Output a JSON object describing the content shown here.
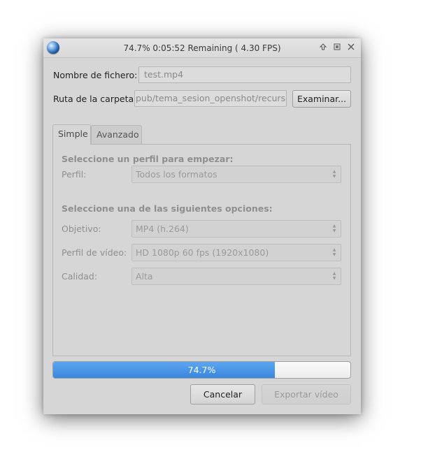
{
  "window": {
    "title": "74.7%  0:05:52 Remaining ( 4.30 FPS)",
    "icon": "openshot-logo-icon",
    "controls": [
      "maximize-icon",
      "restore-icon",
      "close-icon"
    ]
  },
  "file": {
    "name_label": "Nombre de fichero:",
    "name_value": "test.mp4",
    "folder_label": "Ruta de la carpeta:",
    "folder_value": "pub/tema_sesion_openshot/recursos",
    "browse_label": "Examinar..."
  },
  "tabs": [
    {
      "label": "Simple",
      "active": true
    },
    {
      "label": "Avanzado",
      "active": false
    }
  ],
  "simple": {
    "profile_heading": "Seleccione un perfil para empezar:",
    "profile_label": "Perfil:",
    "profile_value": "Todos los formatos",
    "options_heading": "Seleccione una de las siguientes opciones:",
    "target_label": "Objetivo:",
    "target_value": "MP4 (h.264)",
    "video_profile_label": "Perfil de vídeo:",
    "video_profile_value": "HD 1080p 60 fps (1920x1080)",
    "quality_label": "Calidad:",
    "quality_value": "Alta"
  },
  "progress": {
    "percent": 74.7,
    "label": "74.7%"
  },
  "buttons": {
    "cancel": "Cancelar",
    "export": "Exportar vídeo"
  },
  "colors": {
    "progress_fill": "#3a86dc",
    "window_bg": "#d6d6d6"
  }
}
